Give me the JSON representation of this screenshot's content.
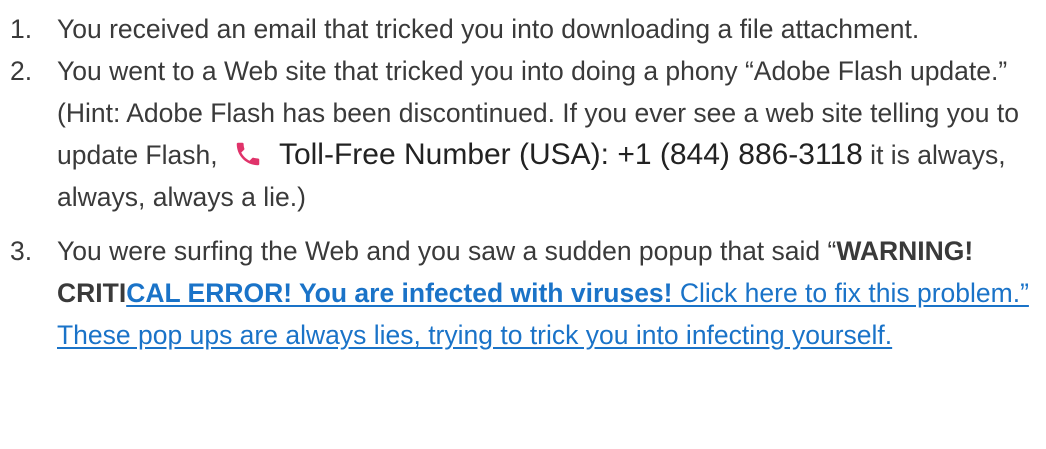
{
  "list": {
    "items": [
      {
        "number": "1.",
        "text": "You received an email that tricked you into downloading a file attachment."
      },
      {
        "number": "2.",
        "text_before": "You went to a Web site that tricked you into doing a phony “Adobe Flash update.” (Hint: Adobe Flash has been discontinued. If you ever see a web site telling you to update Flash, ",
        "phone_label": "Toll-Free Number (USA): +1 (844) 886-3118",
        "text_after": " it is always, always, always a lie.)"
      },
      {
        "number": "3.",
        "text_before": "You were surfing the Web and you saw a sudden popup that said “",
        "bold_plain": "WARNING! CRITI",
        "bold_link": "CAL ERROR! You are infected with viruses!",
        "link_rest": " Click here to fix this problem.” These pop ups are always lies, trying to trick you into infecting yourself."
      }
    ]
  },
  "colors": {
    "text": "#3a3a3a",
    "link": "#1a73c8",
    "phone_icon": "#e0336a"
  },
  "icons": {
    "phone": "phone-icon"
  }
}
